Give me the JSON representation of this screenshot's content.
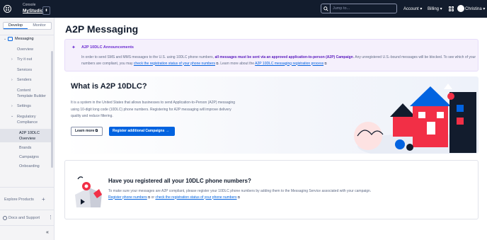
{
  "topbar": {
    "account_caption": "Console",
    "account_name": "MyStudio",
    "account_switcher": "⬍",
    "search_placeholder": "Jump to...",
    "account_menu": "Account ▾",
    "billing_menu": "Billing ▾",
    "user_name": "Christina ▾",
    "colors": {
      "background": "#121c2d"
    }
  },
  "sidebar": {
    "tabs": [
      "Develop",
      "Monitor"
    ],
    "active_tab": "Develop",
    "section": "Messaging",
    "items": [
      {
        "label": "Overview"
      },
      {
        "label": "Try it out"
      },
      {
        "label": "Services"
      },
      {
        "label": "Senders"
      },
      {
        "label": "Content"
      },
      {
        "label": "Template Builder"
      },
      {
        "label": "Settings"
      },
      {
        "label": "Regulatory"
      },
      {
        "label": "Compliance"
      },
      {
        "label": "A2P 10DLC"
      },
      {
        "label": "Overview"
      },
      {
        "label": "Brands"
      },
      {
        "label": "Campaigns"
      },
      {
        "label": "Onboarding"
      }
    ],
    "explore": "Explore Products",
    "docs": "Docs and Support",
    "collapse": "«"
  },
  "main": {
    "title": "A2P Messaging",
    "announcement": {
      "title": "A2P 10DLC Announcements",
      "text_1": "In order to send SMS and MMS messages to the U.S. using 10DLC phone numbers, ",
      "bold": "all messages must be sent via an approved application-to-person (A2P) Campaign",
      "text_2": ". Any unregistered U.S.-bound messages will be blocked. To see which of your numbers are compliant, you may ",
      "link_1": "check the registration status of your phone numbers",
      "text_3": ". Learn more about the ",
      "link_2": "A2P 10DLC messaging registration process"
    },
    "hero": {
      "title": "What is A2P 10DLC?",
      "description": "It is a system in the United States that allows businesses to send Application-to-Person (A2P) messaging using 10-digit long code (10DLC) phone numbers. Registering for A2P messaging will improve delivery quality and reduce filtering.",
      "learn_more": "Learn more ⧉",
      "register": "Register additional Campaigns →"
    },
    "numbers_card": {
      "title": "Have you registered all your 10DLC phone numbers?",
      "text_1": "To make sure your messages are A2P compliant, please register your 10DLC phone numbers by adding them to the Messaging Service associated with your campaign.",
      "link_1": "Register phone numbers",
      "text_2": " or ",
      "link_2": "check the registration status of your phone numbers"
    },
    "colors": {
      "accent": "#0263e0",
      "announce_bg": "#f5f0fc",
      "announce_text": "#6d2ed1"
    }
  }
}
